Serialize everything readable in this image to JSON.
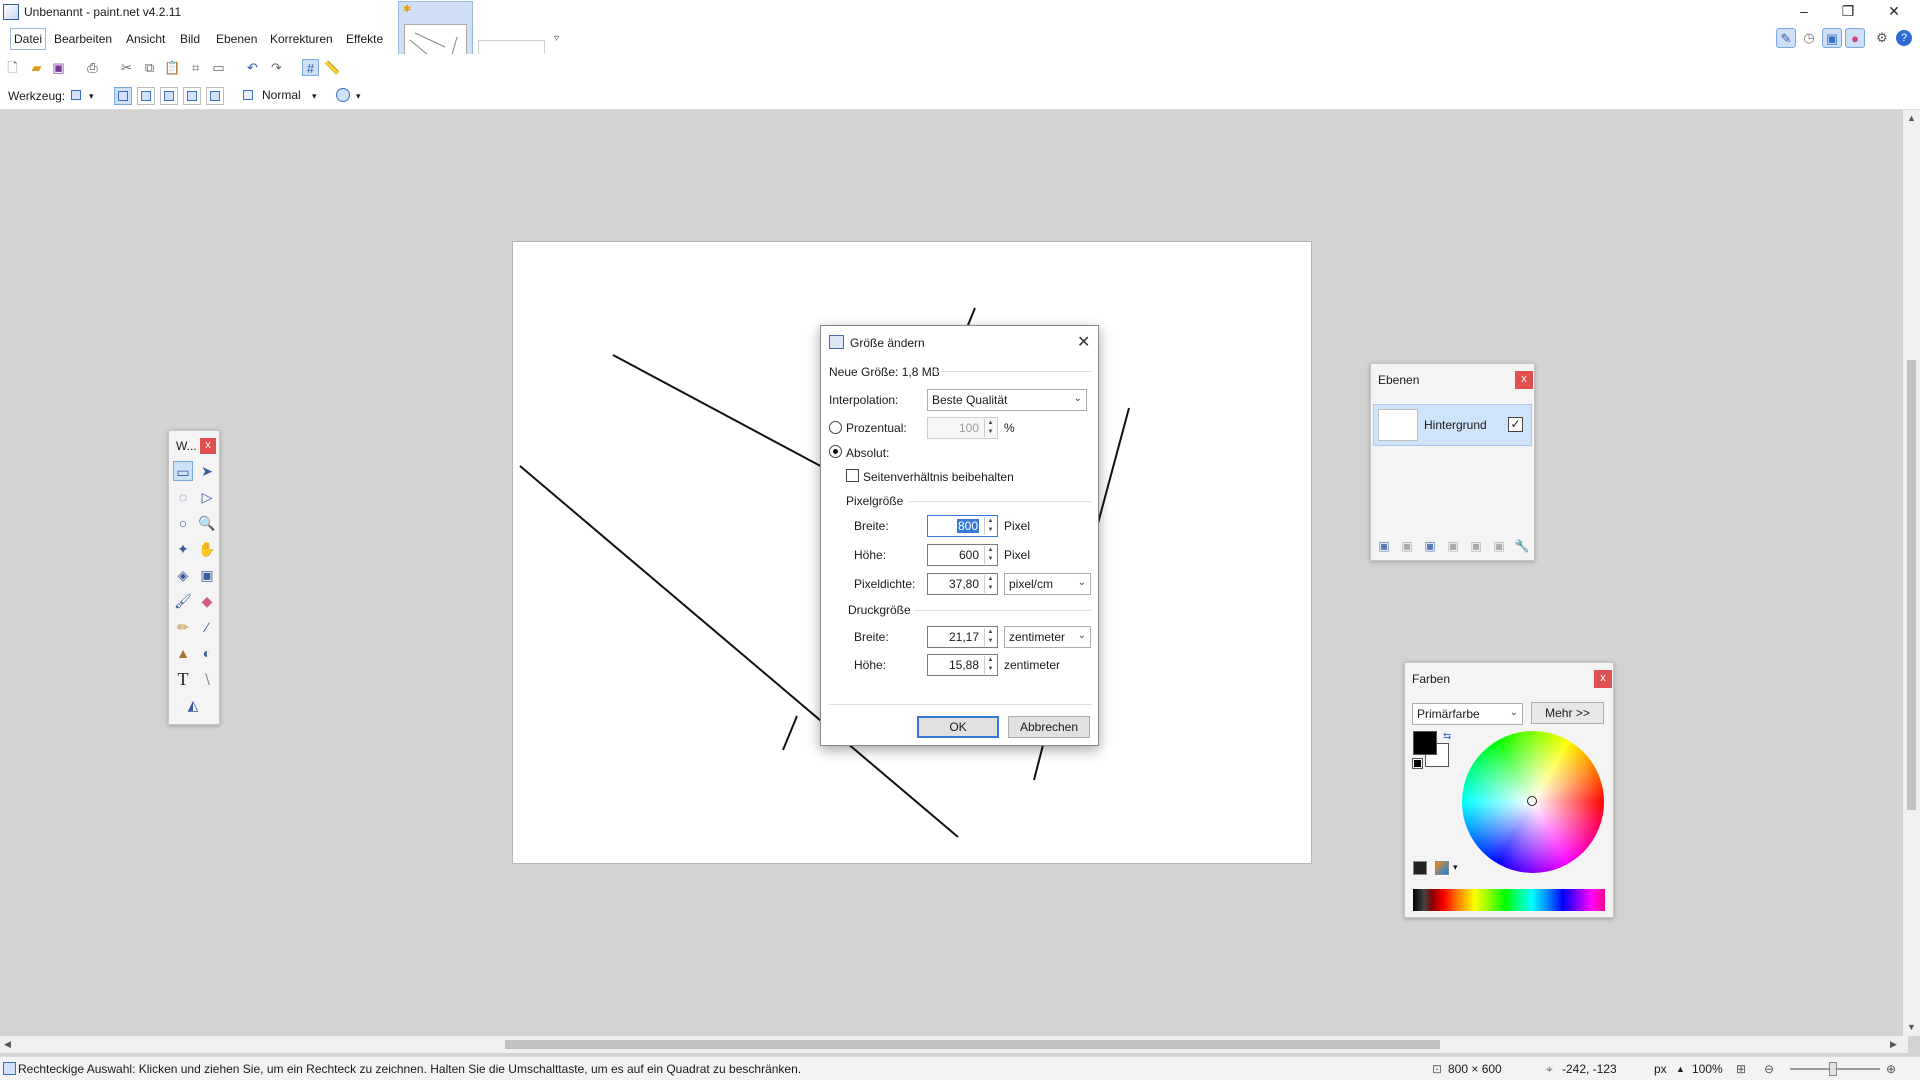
{
  "window": {
    "title": "Unbenannt - paint.net v4.2.11",
    "minimize": "–",
    "maximize": "❐",
    "close": "✕"
  },
  "menu": {
    "items": [
      "Datei",
      "Bearbeiten",
      "Ansicht",
      "Bild",
      "Ebenen",
      "Korrekturen",
      "Effekte"
    ]
  },
  "toolopts": {
    "tool_label": "Werkzeug:",
    "blend_mode": "Normal"
  },
  "tools_panel": {
    "title": "W...",
    "close": "x"
  },
  "layers_panel": {
    "title": "Ebenen",
    "close": "x",
    "layers": [
      {
        "name": "Hintergrund",
        "visible": true
      }
    ]
  },
  "colors_panel": {
    "title": "Farben",
    "close": "x",
    "mode": "Primärfarbe",
    "more_button": "Mehr >>",
    "primary_color": "#000000",
    "secondary_color": "#ffffff"
  },
  "dialog": {
    "title": "Größe ändern",
    "new_size": "Neue Größe: 1,8 MB",
    "interpolation_label": "Interpolation:",
    "interpolation_value": "Beste Qualität",
    "percent_label": "Prozentual:",
    "percent_value": "100",
    "percent_unit": "%",
    "absolute_label": "Absolut:",
    "keep_ratio_label": "Seitenverhältnis beibehalten",
    "pixel_size_heading": "Pixelgröße",
    "width_label": "Breite:",
    "width_value": "800",
    "width_unit": "Pixel",
    "height_label": "Höhe:",
    "height_value": "600",
    "height_unit": "Pixel",
    "density_label": "Pixeldichte:",
    "density_value": "37,80",
    "density_unit": "pixel/cm",
    "print_size_heading": "Druckgröße",
    "print_width_label": "Breite:",
    "print_width_value": "21,17",
    "print_width_unit": "zentimeter",
    "print_height_label": "Höhe:",
    "print_height_value": "15,88",
    "print_height_unit": "zentimeter",
    "ok": "OK",
    "cancel": "Abbrechen"
  },
  "statusbar": {
    "hint": "Rechteckige Auswahl: Klicken und ziehen Sie, um ein Rechteck zu zeichnen. Halten Sie die Umschalttaste, um es auf ein Quadrat zu beschränken.",
    "image_size": "800 × 600",
    "cursor_pos": "-242, -123",
    "unit": "px",
    "zoom": "100%"
  }
}
